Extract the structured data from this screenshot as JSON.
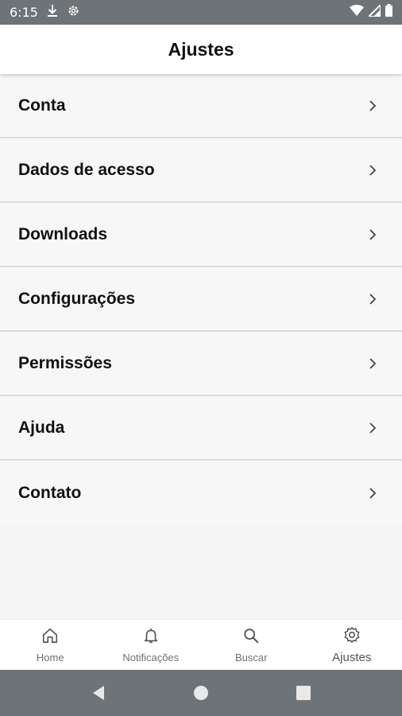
{
  "status_bar": {
    "time": "6:15"
  },
  "app_bar": {
    "title": "Ajustes"
  },
  "menu": {
    "items": [
      {
        "label": "Conta"
      },
      {
        "label": "Dados de acesso"
      },
      {
        "label": "Downloads"
      },
      {
        "label": "Configurações"
      },
      {
        "label": "Permissões"
      },
      {
        "label": "Ajuda"
      },
      {
        "label": "Contato"
      }
    ]
  },
  "bottom_nav": {
    "items": [
      {
        "label": "Home",
        "icon": "home-icon"
      },
      {
        "label": "Notificações",
        "icon": "bell-icon"
      },
      {
        "label": "Buscar",
        "icon": "search-icon"
      },
      {
        "label": "Ajustes",
        "icon": "gear-icon",
        "active": true
      }
    ]
  },
  "colors": {
    "status_bar": "#6e7377",
    "app_bar": "#ffffff",
    "background": "#f7f7f7",
    "divider": "#dcdcdc",
    "nav_label": "#6f6f6f"
  }
}
